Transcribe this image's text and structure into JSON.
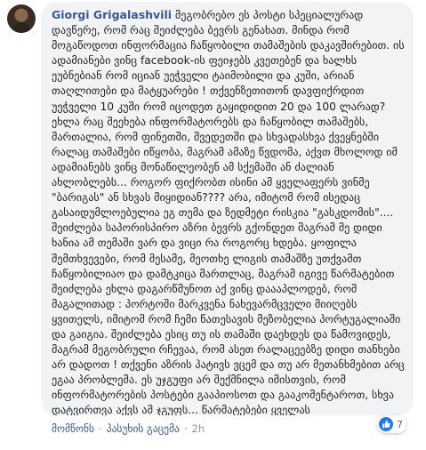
{
  "comment": {
    "author": "Giorgi Grigalashvili",
    "text": "მეგობრებო ეს პოსტი სპეციალურად დავწერე, რომ რაც შეიძლება ბევრს გენახათ. მინდა რომ მოგაწოდოთ ინფორმაცია ჩაწყობილი თამაშების დაკავშირებით. ის ადამიანები ვინც facebook-ის ფეიჯებს კვეთებენ და ხალხს ეუბნებიან რომ იციან უეჭველი ტაიმობილი და კუში, არიან თაღლითები და მატყუარები ! თქვენზეთითონ დავფიქრდით უეჭველი 10 კუში რომ იცოდეთ გაყიდიდით 20 და 100 ლარად? ეხლა რაც შეეხება ინფორმატორებს და ჩაწყობილ თამაშებს, მართალია, რომ ფინეთში, შვედეთში და სხვადასხვა ქვეყნებში რალაც თამაშები იწყობა, მაგრამ ამაზე წვდომა, აქვთ მხოლოდ იმ ადამიანებს ვინც მონაწილეობენ ამ სქემაში ან ძალიან ახლობლებს... როგორ ფიქრობთ ისინი ამ ყველაფერს ვინმე \"ბარიგას\" ან სხვას მიყიდიან???? არა, იმიტომ რომ ისედაც გასაიდუმლოებულია ეგ თემა და ზედმეტი რისკია \"გასკდომის\".... შეიძლება საპორისპირო აზრი ბევრს გქონდეთ მაგრამ მე დიდი ხანია ამ თემაში ვარ და ვიცი რა როგორც ხდება. ყოფილა შემთხვევები, რომ მესამე, მეოთხე ლიგის თამაშზე უთქვამთ ჩაწყობილიაო და დამტკიცა მართლაც, მაგრამ იგივე წარმატებით შეიძლება ეხლა დაგარწმუნოთ აქ ვინც დაააპლოდებ, რომ მაგალითად : პორტოში მარკვენა ნახევარმცველი მიიღებს ყვითელს, იმიტომ რომ ჩემი წათესავის მეზობელია პორტუგალიაში და გაიგია. შეიძლება ესიც თუ ის თამაში დაეხდეს და წამოვიდეს, მაგრამ მეგობრული რჩევაა, რომ ასეთ რალაცეებზე დიდი თანხები არ დადოთ ! თქვენი აზრის პატივს ვცემ და თუ არ მეთანხმებით არც ეგაა პრობლემა. ეს უჯგუფი არ შექმნილა იმისთვის, რომ ინფორმატორების პოსტები გააპიოსოთ და გააკომენტაროთ, სხვა დატვირთვა აქვს ამ ჯგუფს... წარმატებები ყველას"
  },
  "reactions": {
    "icon": "like-icon",
    "count": "7"
  },
  "actions": {
    "like": "მომწონს",
    "reply": "პასუხის გაცემა",
    "time": "2h"
  }
}
